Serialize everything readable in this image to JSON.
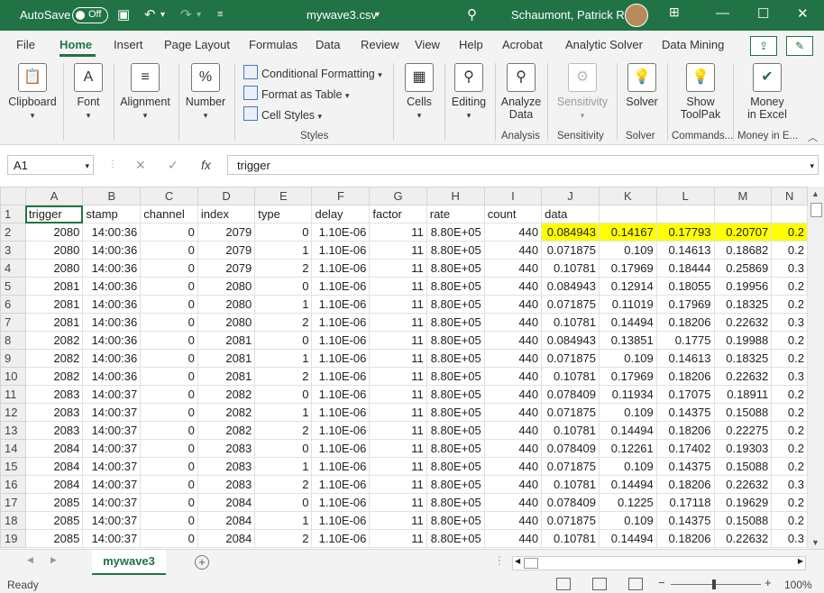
{
  "titlebar": {
    "autosave_label": "AutoSave",
    "autosave_state": "Off",
    "file_title": "mywave3.csv",
    "user_name": "Schaumont, Patrick R."
  },
  "ribbon_tabs": [
    "File",
    "Home",
    "Insert",
    "Page Layout",
    "Formulas",
    "Data",
    "Review",
    "View",
    "Help",
    "Acrobat",
    "Analytic Solver",
    "Data Mining"
  ],
  "active_tab": "Home",
  "ribbon": {
    "clipboard": "Clipboard",
    "font": "Font",
    "alignment": "Alignment",
    "number": "Number",
    "conditional_formatting": "Conditional Formatting",
    "format_as_table": "Format as Table",
    "cell_styles": "Cell Styles",
    "styles_group": "Styles",
    "cells": "Cells",
    "editing": "Editing",
    "analyze_data_1": "Analyze",
    "analyze_data_2": "Data",
    "analysis_group": "Analysis",
    "sensitivity": "Sensitivity",
    "sensitivity_group": "Sensitivity",
    "solver": "Solver",
    "solver_group": "Solver",
    "show_toolpak_1": "Show",
    "show_toolpak_2": "ToolPak",
    "commands_group": "Commands...",
    "money_1": "Money",
    "money_2": "in Excel",
    "money_group": "Money in E..."
  },
  "formula_bar": {
    "name_box": "A1",
    "fx": "fx",
    "formula": "trigger"
  },
  "columns": [
    "A",
    "B",
    "C",
    "D",
    "E",
    "F",
    "G",
    "H",
    "I",
    "J",
    "K",
    "L",
    "M",
    "N"
  ],
  "header_row": [
    "trigger",
    "stamp",
    "channel",
    "index",
    "type",
    "delay",
    "factor",
    "rate",
    "count",
    "data",
    "",
    "",
    "",
    ""
  ],
  "rows": [
    [
      "2080",
      "14:00:36",
      "0",
      "2079",
      "0",
      "1.10E-06",
      "11",
      "8.80E+05",
      "440",
      "0.084943",
      "0.14167",
      "0.17793",
      "0.20707",
      "0.2"
    ],
    [
      "2080",
      "14:00:36",
      "0",
      "2079",
      "1",
      "1.10E-06",
      "11",
      "8.80E+05",
      "440",
      "0.071875",
      "0.109",
      "0.14613",
      "0.18682",
      "0.2"
    ],
    [
      "2080",
      "14:00:36",
      "0",
      "2079",
      "2",
      "1.10E-06",
      "11",
      "8.80E+05",
      "440",
      "0.10781",
      "0.17969",
      "0.18444",
      "0.25869",
      "0.3"
    ],
    [
      "2081",
      "14:00:36",
      "0",
      "2080",
      "0",
      "1.10E-06",
      "11",
      "8.80E+05",
      "440",
      "0.084943",
      "0.12914",
      "0.18055",
      "0.19956",
      "0.2"
    ],
    [
      "2081",
      "14:00:36",
      "0",
      "2080",
      "1",
      "1.10E-06",
      "11",
      "8.80E+05",
      "440",
      "0.071875",
      "0.11019",
      "0.17969",
      "0.18325",
      "0.2"
    ],
    [
      "2081",
      "14:00:36",
      "0",
      "2080",
      "2",
      "1.10E-06",
      "11",
      "8.80E+05",
      "440",
      "0.10781",
      "0.14494",
      "0.18206",
      "0.22632",
      "0.3"
    ],
    [
      "2082",
      "14:00:36",
      "0",
      "2081",
      "0",
      "1.10E-06",
      "11",
      "8.80E+05",
      "440",
      "0.084943",
      "0.13851",
      "0.1775",
      "0.19988",
      "0.2"
    ],
    [
      "2082",
      "14:00:36",
      "0",
      "2081",
      "1",
      "1.10E-06",
      "11",
      "8.80E+05",
      "440",
      "0.071875",
      "0.109",
      "0.14613",
      "0.18325",
      "0.2"
    ],
    [
      "2082",
      "14:00:36",
      "0",
      "2081",
      "2",
      "1.10E-06",
      "11",
      "8.80E+05",
      "440",
      "0.10781",
      "0.17969",
      "0.18206",
      "0.22632",
      "0.3"
    ],
    [
      "2083",
      "14:00:37",
      "0",
      "2082",
      "0",
      "1.10E-06",
      "11",
      "8.80E+05",
      "440",
      "0.078409",
      "0.11934",
      "0.17075",
      "0.18911",
      "0.2"
    ],
    [
      "2083",
      "14:00:37",
      "0",
      "2082",
      "1",
      "1.10E-06",
      "11",
      "8.80E+05",
      "440",
      "0.071875",
      "0.109",
      "0.14375",
      "0.15088",
      "0.2"
    ],
    [
      "2083",
      "14:00:37",
      "0",
      "2082",
      "2",
      "1.10E-06",
      "11",
      "8.80E+05",
      "440",
      "0.10781",
      "0.14494",
      "0.18206",
      "0.22275",
      "0.2"
    ],
    [
      "2084",
      "14:00:37",
      "0",
      "2083",
      "0",
      "1.10E-06",
      "11",
      "8.80E+05",
      "440",
      "0.078409",
      "0.12261",
      "0.17402",
      "0.19303",
      "0.2"
    ],
    [
      "2084",
      "14:00:37",
      "0",
      "2083",
      "1",
      "1.10E-06",
      "11",
      "8.80E+05",
      "440",
      "0.071875",
      "0.109",
      "0.14375",
      "0.15088",
      "0.2"
    ],
    [
      "2084",
      "14:00:37",
      "0",
      "2083",
      "2",
      "1.10E-06",
      "11",
      "8.80E+05",
      "440",
      "0.10781",
      "0.14494",
      "0.18206",
      "0.22632",
      "0.3"
    ],
    [
      "2085",
      "14:00:37",
      "0",
      "2084",
      "0",
      "1.10E-06",
      "11",
      "8.80E+05",
      "440",
      "0.078409",
      "0.1225",
      "0.17118",
      "0.19629",
      "0.2"
    ],
    [
      "2085",
      "14:00:37",
      "0",
      "2084",
      "1",
      "1.10E-06",
      "11",
      "8.80E+05",
      "440",
      "0.071875",
      "0.109",
      "0.14375",
      "0.15088",
      "0.2"
    ],
    [
      "2085",
      "14:00:37",
      "0",
      "2084",
      "2",
      "1.10E-06",
      "11",
      "8.80E+05",
      "440",
      "0.10781",
      "0.14494",
      "0.18206",
      "0.22632",
      "0.3"
    ]
  ],
  "sheet_tab": "mywave3",
  "status": {
    "ready": "Ready",
    "zoom": "100%"
  },
  "colors": {
    "accent": "#217346",
    "highlight": "#ffff00"
  }
}
